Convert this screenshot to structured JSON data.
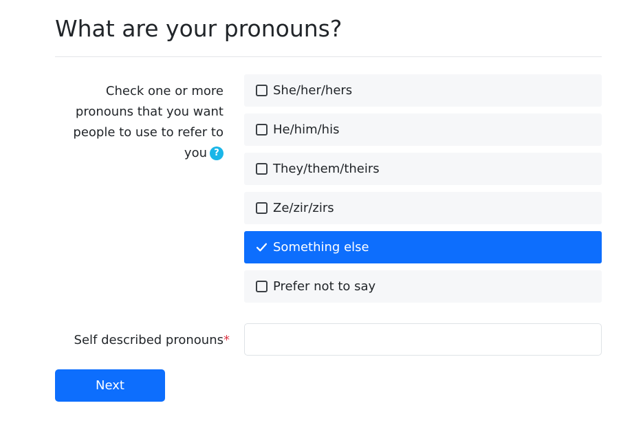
{
  "page": {
    "title": "What are your pronouns?"
  },
  "question": {
    "label": "Check one or more pronouns that you want people to use to refer to you",
    "help_icon": "?"
  },
  "options": [
    {
      "label": "She/her/hers",
      "checked": false
    },
    {
      "label": "He/him/his",
      "checked": false
    },
    {
      "label": "They/them/theirs",
      "checked": false
    },
    {
      "label": "Ze/zir/zirs",
      "checked": false
    },
    {
      "label": "Something else",
      "checked": true
    },
    {
      "label": "Prefer not to say",
      "checked": false
    }
  ],
  "self_described": {
    "label": "Self described pronouns",
    "required_marker": "*",
    "value": ""
  },
  "actions": {
    "next_label": "Next"
  },
  "colors": {
    "primary": "#0d6efd",
    "help_icon": "#1ab6e8",
    "option_bg": "#f6f7f9",
    "required": "#dc3545"
  },
  "icons": {
    "help": "question-circle-icon",
    "checked": "checkmark-icon",
    "unchecked": "checkbox-empty-icon"
  }
}
